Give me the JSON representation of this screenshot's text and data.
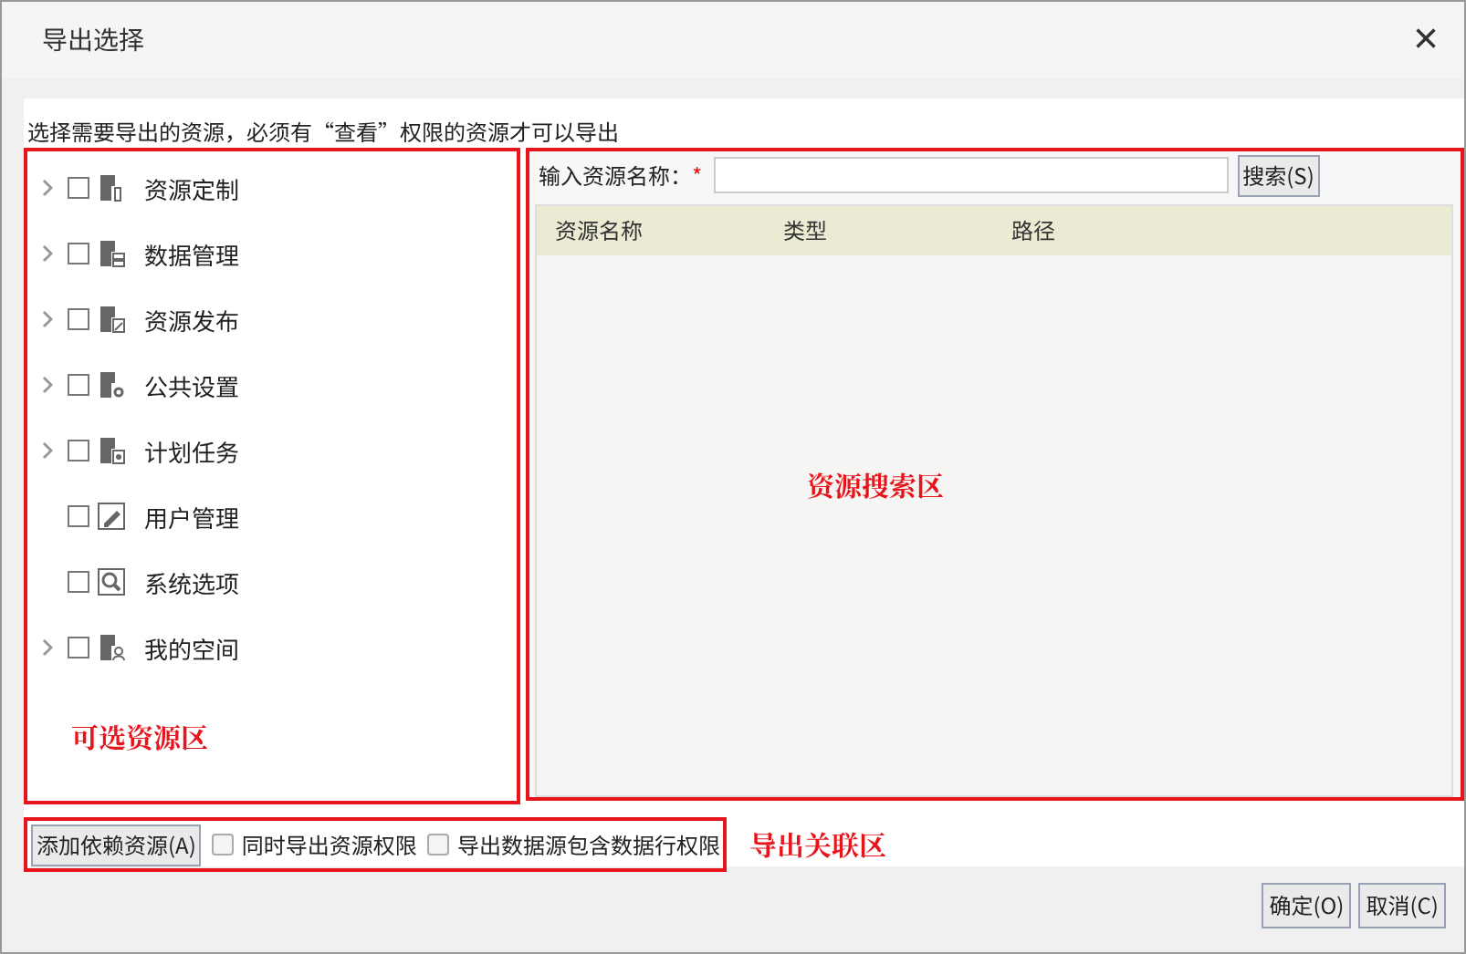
{
  "window": {
    "title": "导出选择",
    "close": "×"
  },
  "instruction": "选择需要导出的资源，必须有“查看”权限的资源才可以导出",
  "tree": {
    "annotation": "可选资源区",
    "items": [
      {
        "label": "资源定制",
        "kind": "custom",
        "expandable": true,
        "checked": false
      },
      {
        "label": "数据管理",
        "kind": "data",
        "expandable": true,
        "checked": false
      },
      {
        "label": "资源发布",
        "kind": "publish",
        "expandable": true,
        "checked": false
      },
      {
        "label": "公共设置",
        "kind": "settings",
        "expandable": true,
        "checked": false
      },
      {
        "label": "计划任务",
        "kind": "task",
        "expandable": true,
        "checked": false
      },
      {
        "label": "用户管理",
        "kind": "user",
        "expandable": false,
        "checked": false
      },
      {
        "label": "系统选项",
        "kind": "system",
        "expandable": false,
        "checked": false
      },
      {
        "label": "我的空间",
        "kind": "space",
        "expandable": true,
        "checked": false
      }
    ]
  },
  "search": {
    "label": "输入资源名称：",
    "required": "*",
    "button": "搜索(S)",
    "annotation": "资源搜索区",
    "table": {
      "columns": [
        "资源名称",
        "类型",
        "路径"
      ]
    }
  },
  "export_options": {
    "annotation": "导出关联区",
    "button": "添加依赖资源(A)",
    "checkboxes": [
      {
        "label": "同时导出资源权限",
        "checked": false
      },
      {
        "label": "导出数据源包含数据行权限",
        "checked": false
      }
    ]
  },
  "buttons": [
    "确定(O)",
    "取消(C)"
  ]
}
